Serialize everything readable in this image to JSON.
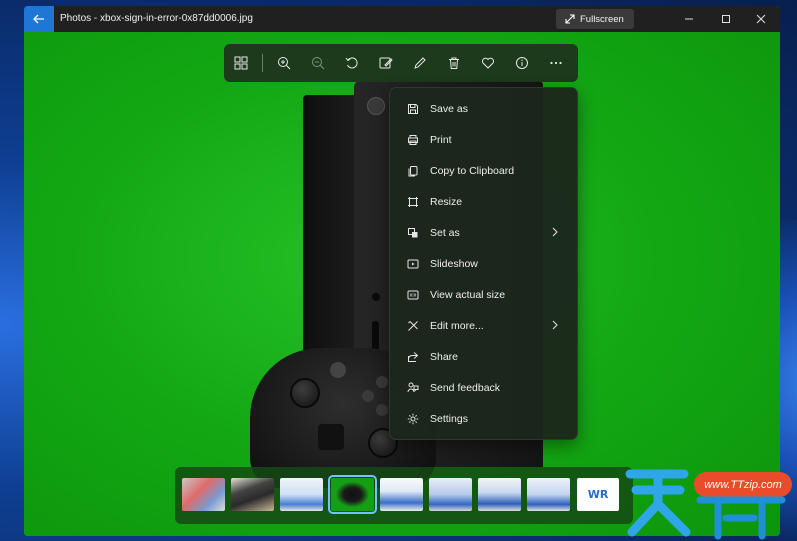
{
  "window": {
    "app_title": "Photos - xbox-sign-in-error-0x87dd0006.jpg",
    "fullscreen_label": "Fullscreen"
  },
  "colors": {
    "titlebar": "#202020",
    "back_button": "#1e77d6",
    "photo_background": "#14a814",
    "menu_background": "#1c261c",
    "selected_thumb_outline": "#6fc3ff",
    "watermark_pill": "#e94c2a"
  },
  "toolbar": {
    "buttons": [
      {
        "icon": "gallery-icon"
      },
      {
        "icon": "zoom-in-icon"
      },
      {
        "icon": "zoom-out-icon"
      },
      {
        "icon": "rotate-icon"
      },
      {
        "icon": "edit-image-icon"
      },
      {
        "icon": "draw-icon"
      },
      {
        "icon": "delete-icon"
      },
      {
        "icon": "favorite-heart-icon"
      },
      {
        "icon": "info-icon"
      },
      {
        "icon": "more-options-icon"
      }
    ]
  },
  "context_menu": {
    "items": [
      {
        "label": "Save as",
        "icon": "save-icon"
      },
      {
        "label": "Print",
        "icon": "print-icon"
      },
      {
        "label": "Copy to Clipboard",
        "icon": "copy-icon"
      },
      {
        "label": "Resize",
        "icon": "resize-icon"
      },
      {
        "label": "Set as",
        "icon": "set-as-icon",
        "submenu": true
      },
      {
        "label": "Slideshow",
        "icon": "slideshow-icon"
      },
      {
        "label": "View actual size",
        "icon": "actual-size-icon"
      },
      {
        "label": "Edit more...",
        "icon": "edit-more-icon",
        "submenu": true
      },
      {
        "label": "Share",
        "icon": "share-icon"
      },
      {
        "label": "Send feedback",
        "icon": "feedback-icon"
      },
      {
        "label": "Settings",
        "icon": "settings-icon"
      }
    ]
  },
  "filmstrip": {
    "selected_index": 3,
    "thumbnail_count": 9,
    "last_thumb_text": "WR"
  },
  "watermark": {
    "pill_text": "www.TTzip.com"
  }
}
